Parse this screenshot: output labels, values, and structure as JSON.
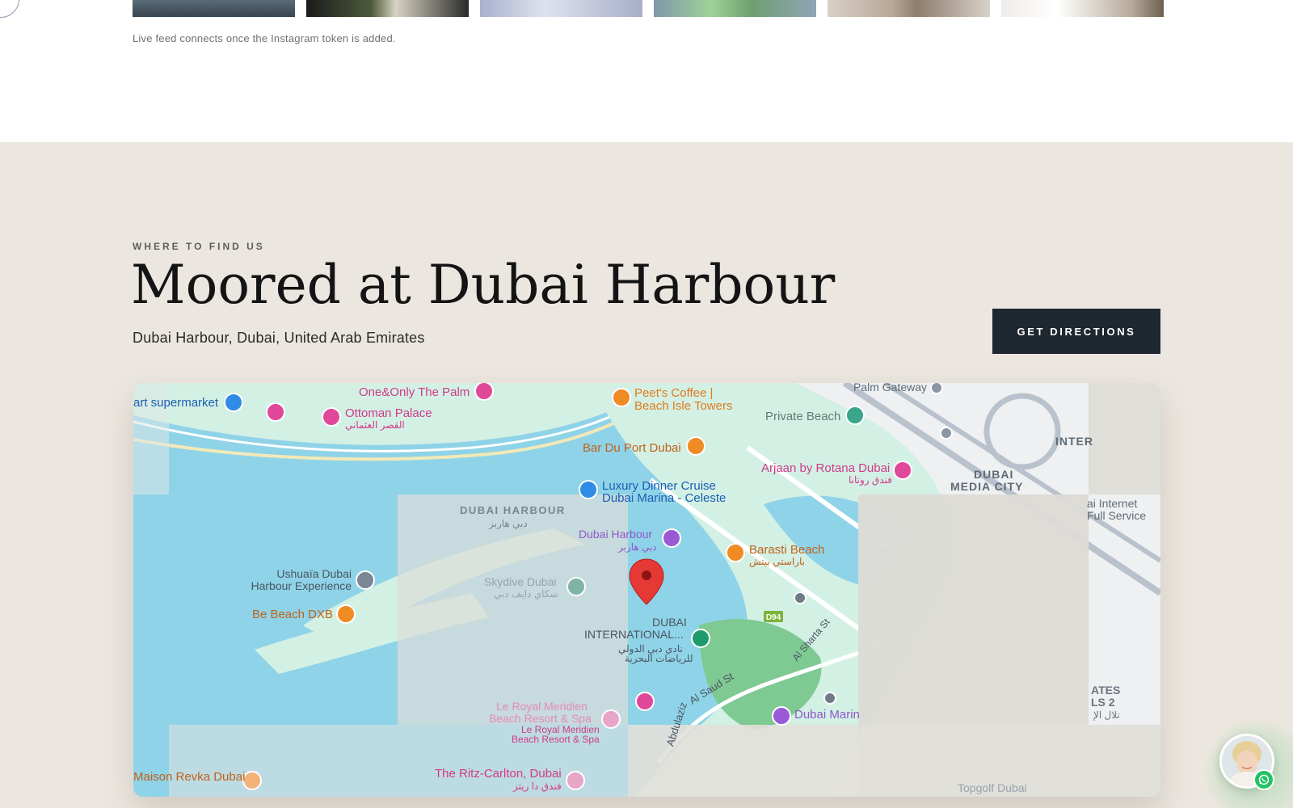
{
  "gallery": {
    "thumbnails": [
      {
        "icon": "photo-sea"
      },
      {
        "icon": "photo-flowers"
      },
      {
        "icon": "photo-tableware"
      },
      {
        "icon": "photo-greenery"
      },
      {
        "icon": "photo-ceramics"
      },
      {
        "icon": "photo-interior"
      }
    ],
    "note": "Live feed connects once the Instagram token is added."
  },
  "location": {
    "eyebrow": "WHERE TO FIND US",
    "title": "Moored at Dubai Harbour",
    "address": "Dubai Harbour, Dubai, United Arab Emirates",
    "directions_label": "GET DIRECTIONS"
  },
  "map": {
    "labels": {
      "supermarket": "art supermarket",
      "one_only": "One&Only The Palm",
      "ottoman": "Ottoman Palace",
      "ottoman_ar": "القصر العثماني",
      "peets_1": "Peet's Coffee |",
      "peets_2": "Beach Isle Towers",
      "palm_gateway": "Palm Gateway",
      "private_beach": "Private Beach",
      "bar_du_port": "Bar Du Port Dubai",
      "arjaan": "Arjaan by Rotana Dubai",
      "arjaan_ar": "فندق روتانا",
      "media_city_1": "DUBAI",
      "media_city_2": "MEDIA CITY",
      "inter": "INTER",
      "dinner_cruise_1": "Luxury Dinner Cruise",
      "dinner_cruise_2": "Dubai Marina - Celeste",
      "dubai_harbour_caps": "DUBAI HARBOUR",
      "dubai_harbour_caps_ar": "دبي هاربر",
      "dubai_harbour": "Dubai Harbour",
      "dubai_harbour_ar": "دبي هاربر",
      "internet_1": "ai Internet",
      "internet_2": "Full Service",
      "barasti": "Barasti Beach",
      "barasti_ar": "باراستي بيتش",
      "ushuaia_1": "Ushuaïa Dubai",
      "ushuaia_2": "Harbour Experience",
      "skydive": "Skydive Dubai",
      "skydive_ar": "سكاي دايف دبي",
      "be_beach": "Be Beach DXB",
      "d94": "D94",
      "al_sharta": "Al Sharta St",
      "intl_1": "DUBAI",
      "intl_2": "INTERNATIONAL...",
      "intl_ar_1": "نادي دبي الدولي",
      "intl_ar_2": "للرياضات البحرية",
      "al_saud": "Al Saud St",
      "aziz": "Abdulaziz",
      "ates_1": "ATES",
      "ates_2": "LS 2",
      "ates_ar": "تلال الإ",
      "le_royal_1": "Le Royal Meridien",
      "le_royal_2": "Beach Resort & Spa",
      "le_royal_3": "Le Royal Meridien",
      "le_royal_4": "Beach Resort & Spa",
      "dubai_marina": "Dubai Marin",
      "ritz": "The Ritz-Carlton, Dubai",
      "ritz_ar": "فندق دا ريتز",
      "maison": "Maison Revka Dubai",
      "topgolf": "Topgolf Dubai"
    },
    "colors": {
      "water": "#8fd3e8",
      "land": "#cfeee0",
      "road": "#ffffff",
      "pin": "#e53935",
      "hotel": "#e0489a",
      "food": "#f08a24",
      "shop": "#2f8be6",
      "camera": "#9a5ad6"
    }
  },
  "chat": {
    "avatar_icon": "agent-avatar",
    "badge_icon": "whatsapp-icon",
    "badge_color": "#25c264"
  }
}
